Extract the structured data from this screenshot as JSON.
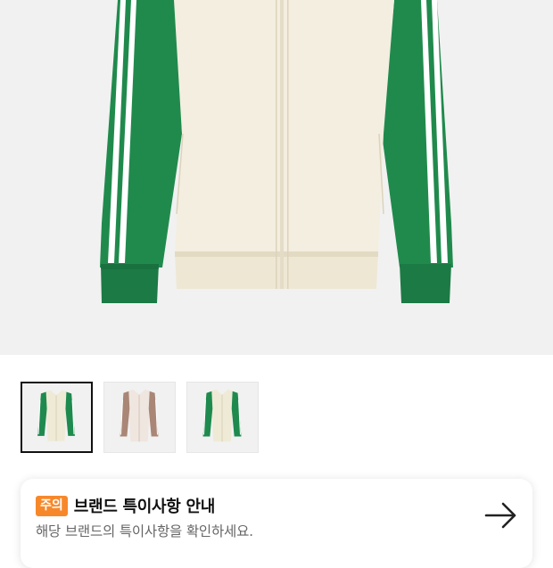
{
  "product_image": {
    "alt": "product-main-image",
    "selected_index": 0
  },
  "thumbnails": [
    {
      "name": "green-cream-jacket",
      "body_color": "#efead6",
      "sleeve_color": "#1e8a4e",
      "stripe_color": "#ffffff"
    },
    {
      "name": "brown-beige-jacket",
      "body_color": "#efe6e0",
      "sleeve_color": "#a98676",
      "stripe_color": "#ffffff"
    },
    {
      "name": "green-cream-jacket-alt",
      "body_color": "#efead6",
      "sleeve_color": "#1e8a4e",
      "stripe_color": "#ffffff"
    }
  ],
  "notice": {
    "badge": "주의",
    "title": "브랜드 특이사항 안내",
    "description": "해당 브랜드의 특이사항을 확인하세요.",
    "arrow_icon": "arrow-right-icon"
  },
  "colors": {
    "badge_bg": "#f7882a",
    "image_bg": "#f1f1f1",
    "jacket_green": "#1e8a4e",
    "jacket_cream": "#f2edde"
  }
}
